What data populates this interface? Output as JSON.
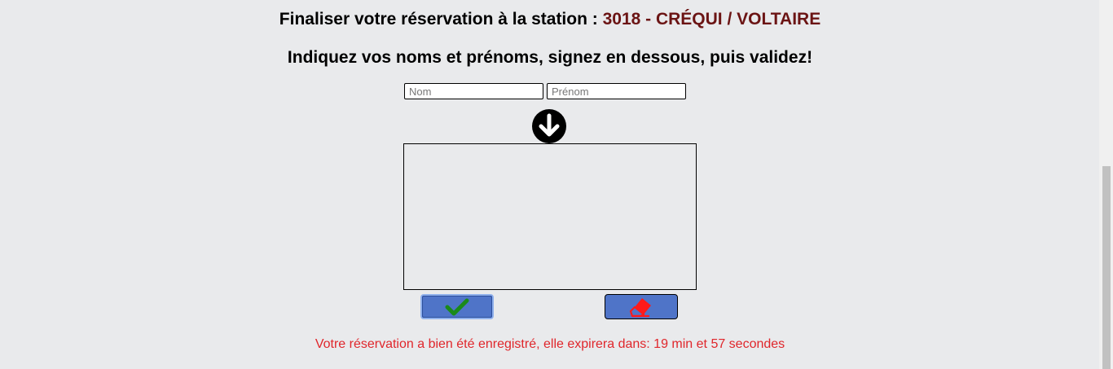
{
  "header": {
    "title_prefix": "Finaliser votre réservation à la station : ",
    "station_name": "3018 - CRÉQUI / VOLTAIRE",
    "instruction": "Indiquez vos noms et prénoms, signez en dessous, puis validez!"
  },
  "form": {
    "nom_placeholder": "Nom",
    "nom_value": "",
    "prenom_placeholder": "Prénom",
    "prenom_value": ""
  },
  "icons": {
    "signature_hint": "arrow-down-circle-icon",
    "validate": "check-icon",
    "erase": "eraser-icon"
  },
  "colors": {
    "station": "#6b1414",
    "button": "#4f74c8",
    "check": "#1a8a1a",
    "eraser": "#ff1a1a",
    "status": "#e0262b"
  },
  "status": {
    "message": "Votre réservation a bien été enregistré, elle expirera dans: 19 min et 57 secondes"
  }
}
